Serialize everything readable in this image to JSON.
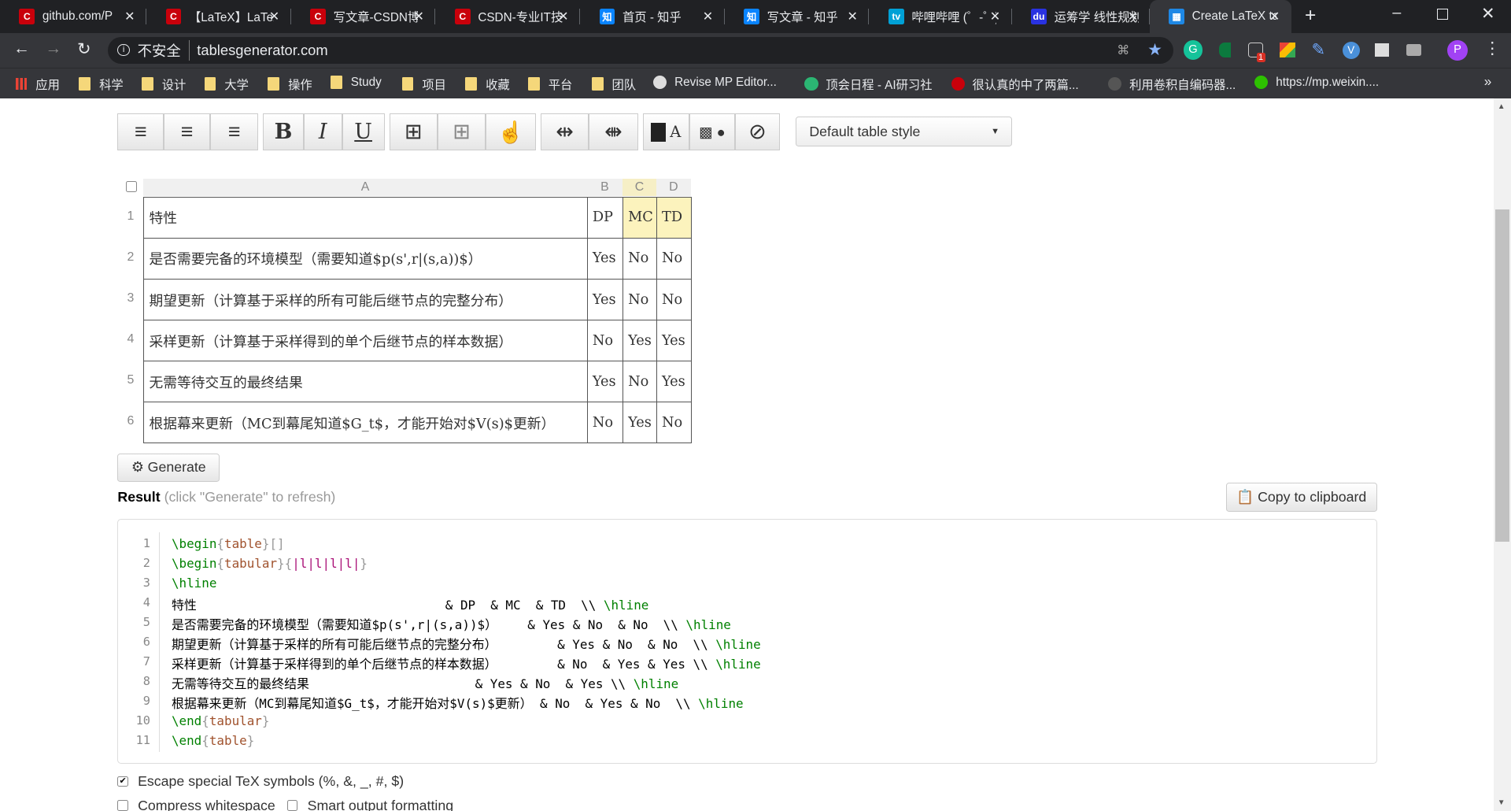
{
  "browser": {
    "tabs": [
      {
        "title": "github.com/P",
        "icon": "csdn-icon",
        "color": "#c9000b",
        "glyph": "C"
      },
      {
        "title": "【LaTeX】LaTeX",
        "icon": "csdn-icon",
        "color": "#c9000b",
        "glyph": "C"
      },
      {
        "title": "写文章-CSDN博客",
        "icon": "csdn-icon",
        "color": "#c9000b",
        "glyph": "C"
      },
      {
        "title": "CSDN-专业IT技术社区",
        "icon": "csdn-icon",
        "color": "#c9000b",
        "glyph": "C"
      },
      {
        "title": "首页 - 知乎",
        "icon": "zhihu-icon",
        "color": "#0a84ff",
        "glyph": "知"
      },
      {
        "title": "写文章 - 知乎",
        "icon": "zhihu-icon",
        "color": "#0a84ff",
        "glyph": "知"
      },
      {
        "title": "哔哩哔哩 (゜-゜)",
        "icon": "bilibili-icon",
        "color": "#00a1d6",
        "glyph": "tv"
      },
      {
        "title": "运筹学 线性规划",
        "icon": "baidu-icon",
        "color": "#2932e1",
        "glyph": "du"
      },
      {
        "title": "Create LaTeX tables",
        "icon": "tablesgenerator-icon",
        "color": "#1e88e5",
        "glyph": "▦",
        "active": true
      }
    ],
    "security_label": "不安全",
    "url": "tablesgenerator.com",
    "bookmarks": [
      {
        "label": "应用",
        "icon": "apps-icon"
      },
      {
        "label": "科学",
        "icon": "folder-icon"
      },
      {
        "label": "设计",
        "icon": "folder-icon"
      },
      {
        "label": "大学",
        "icon": "folder-icon"
      },
      {
        "label": "操作",
        "icon": "folder-icon"
      },
      {
        "label": "Study",
        "icon": "folder-icon"
      },
      {
        "label": "项目",
        "icon": "folder-icon"
      },
      {
        "label": "收藏",
        "icon": "folder-icon"
      },
      {
        "label": "平台",
        "icon": "folder-icon"
      },
      {
        "label": "团队",
        "icon": "folder-icon"
      },
      {
        "label": "Revise MP Editor...",
        "icon": "globe-icon"
      },
      {
        "label": "顶会日程 - AI研习社",
        "icon": "aiyanxishe-icon"
      },
      {
        "label": "很认真的中了两篇...",
        "icon": "csdn-icon"
      },
      {
        "label": "利用卷积自编码器...",
        "icon": "page-icon"
      },
      {
        "label": "https://mp.weixin....",
        "icon": "wechat-icon"
      }
    ],
    "more_bookmarks": "»",
    "profile_initial": "P",
    "extension_badge": "1"
  },
  "editor": {
    "table_style": "Default table style",
    "columns": [
      "A",
      "B",
      "C",
      "D"
    ],
    "rows": [
      [
        "特性",
        "DP",
        "MC",
        "TD"
      ],
      [
        "是否需要完备的环境模型（需要知道$p(s',r|(s,a))$）",
        "Yes",
        "No",
        "No"
      ],
      [
        "期望更新（计算基于采样的所有可能后继节点的完整分布）",
        "Yes",
        "No",
        "No"
      ],
      [
        "采样更新（计算基于采样得到的单个后继节点的样本数据）",
        "No",
        "Yes",
        "Yes"
      ],
      [
        "无需等待交互的最终结果",
        "Yes",
        "No",
        "Yes"
      ],
      [
        "根据幕来更新（MC到幕尾知道$G_t$，才能开始对$V(s)$更新）",
        "No",
        "Yes",
        "No"
      ]
    ],
    "highlight_color": "#fcf3bd",
    "generate_label": "Generate",
    "result_label": "Result",
    "result_hint": "(click \"Generate\" to refresh)",
    "copy_label": "Copy to clipboard"
  },
  "code": [
    [
      [
        "cmd",
        "\\begin"
      ],
      [
        "brace",
        "{"
      ],
      [
        "arg",
        "table"
      ],
      [
        "brace",
        "}[]"
      ]
    ],
    [
      [
        "cmd",
        "\\begin"
      ],
      [
        "brace",
        "{"
      ],
      [
        "arg",
        "tabular"
      ],
      [
        "brace",
        "}{"
      ],
      [
        "spec",
        "|l|l|l|l|"
      ],
      [
        "brace",
        "}"
      ]
    ],
    [
      [
        "cmd",
        "\\hline"
      ]
    ],
    [
      [
        "text",
        "特性                                 & DP  & MC  & TD  \\\\ "
      ],
      [
        "cmd",
        "\\hline"
      ]
    ],
    [
      [
        "text",
        "是否需要完备的环境模型（需要知道$p(s',r|(s,a))$）    & Yes & No  & No  \\\\ "
      ],
      [
        "cmd",
        "\\hline"
      ]
    ],
    [
      [
        "text",
        "期望更新（计算基于采样的所有可能后继节点的完整分布）        & Yes & No  & No  \\\\ "
      ],
      [
        "cmd",
        "\\hline"
      ]
    ],
    [
      [
        "text",
        "采样更新（计算基于采样得到的单个后继节点的样本数据）        & No  & Yes & Yes \\\\ "
      ],
      [
        "cmd",
        "\\hline"
      ]
    ],
    [
      [
        "text",
        "无需等待交互的最终结果                      & Yes & No  & Yes \\\\ "
      ],
      [
        "cmd",
        "\\hline"
      ]
    ],
    [
      [
        "text",
        "根据幕来更新（MC到幕尾知道$G_t$，才能开始对$V(s)$更新） & No  & Yes & No  \\\\ "
      ],
      [
        "cmd",
        "\\hline"
      ]
    ],
    [
      [
        "cmd",
        "\\end"
      ],
      [
        "brace",
        "{"
      ],
      [
        "arg",
        "tabular"
      ],
      [
        "brace",
        "}"
      ]
    ],
    [
      [
        "cmd",
        "\\end"
      ],
      [
        "brace",
        "{"
      ],
      [
        "arg",
        "table"
      ],
      [
        "brace",
        "}"
      ]
    ]
  ],
  "options": [
    {
      "label": "Escape special TeX symbols (%, &, _, #, $)",
      "checked": true
    },
    {
      "label": "Compress whitespace",
      "checked": false
    },
    {
      "label": "Smart output formatting",
      "checked": false
    }
  ]
}
